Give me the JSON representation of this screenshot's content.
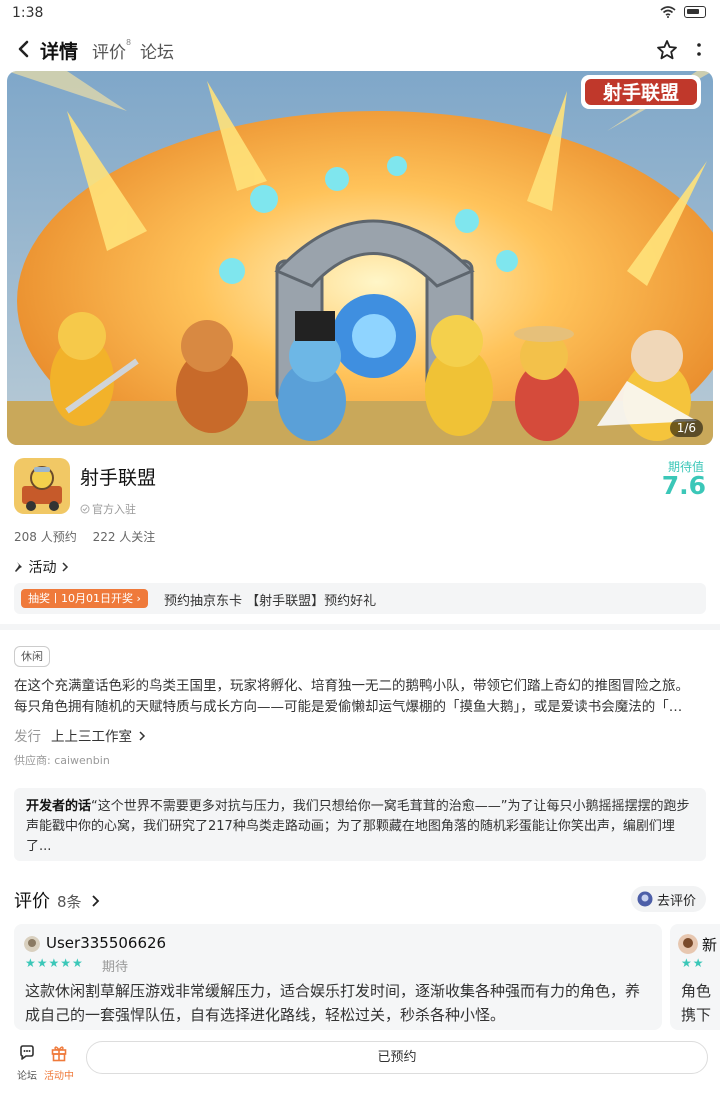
{
  "status": {
    "time": "1:38"
  },
  "nav": {
    "tabs": [
      {
        "label": "详情"
      },
      {
        "label": "评价",
        "badge": "8"
      },
      {
        "label": "论坛"
      }
    ]
  },
  "banner": {
    "logo_text": "射手联盟",
    "counter": "1/6"
  },
  "game": {
    "name": "射手联盟",
    "official": "官方入驻",
    "expect_label": "期待值",
    "expect_value": "7.6",
    "reservations": "208 人预约",
    "followers": "222 人关注",
    "activity_label": "活动",
    "promo_tag": "抽奖丨10月01日开奖",
    "promo_text": "预约抽京东卡 【射手联盟】预约好礼"
  },
  "detail": {
    "genre": "休闲",
    "desc_line1": "在这个充满童话色彩的鸟类王国里，玩家将孵化、培育独一无二的鹅鸭小队，带领它们踏上奇幻的推图冒险之旅。",
    "desc_line2": "每只角色拥有随机的天赋特质与成长方向——可能是爱偷懒却运气爆棚的「摸鱼大鹅」，或是爱读书会魔法的「…",
    "publisher_label": "发行",
    "publisher": "上上三工作室",
    "supplier": "供应商: caiwenbin",
    "dev_label": "开发者的话",
    "dev_text": "“这个世界不需要更多对抗与压力，我们只想给你一窝毛茸茸的治愈——”为了让每只小鹅摇摇摆摆的跑步声能戳中你的心窝，我们研究了217种鸟类走路动画；为了那颗藏在地图角落的随机彩蛋能让你笑出声，编剧们埋了..."
  },
  "reviews": {
    "title": "评价",
    "count": "8条",
    "write_button": "去评价",
    "items": [
      {
        "user": "User335506626",
        "stars": "★★★★★",
        "tag": "期待",
        "text": "这款休闲割草解压游戏非常缓解压力，适合娱乐打发时间，逐渐收集各种强而有力的角色，养成自己的一套强悍队伍，自有选择进化路线，轻松过关，秒杀各种小怪。"
      },
      {
        "user": "新",
        "stars": "★★",
        "text": "角色携下来,"
      }
    ]
  },
  "bottom": {
    "forum": "论坛",
    "events": "活动中",
    "reserve": "已预约"
  },
  "colors": {
    "accent": "#3bc7b8",
    "promo": "#ef7a3b"
  }
}
